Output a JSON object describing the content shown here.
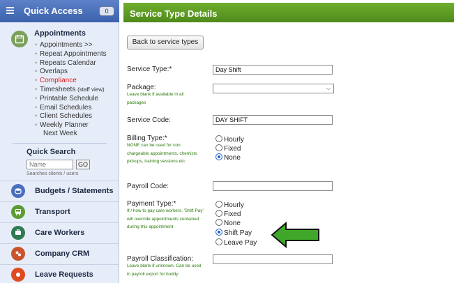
{
  "sidebar": {
    "title": "Quick Access",
    "count": "0",
    "appointments": {
      "title": "Appointments",
      "icon": "calendar-icon",
      "items": [
        {
          "label": "Appointments >>"
        },
        {
          "label": "Repeat Appointments"
        },
        {
          "label": "Repeats Calendar"
        },
        {
          "label": "Overlaps"
        },
        {
          "label": "Compliance",
          "color": "#e01b1b"
        },
        {
          "label": "Timesheets",
          "suffix": "(staff view)"
        },
        {
          "label": "Printable Schedule"
        },
        {
          "label": "Email Schedules"
        },
        {
          "label": "Client Schedules"
        },
        {
          "label": "Weekly Planner"
        },
        {
          "label": "Next Week"
        }
      ]
    },
    "quick_search": {
      "title": "Quick Search",
      "placeholder": "Name",
      "go_label": "GO",
      "hint": "Searches clients / users"
    },
    "modules": [
      {
        "label": "Budgets / Statements",
        "icon": "coins-icon",
        "color": "#4a6fc0"
      },
      {
        "label": "Transport",
        "icon": "bus-icon",
        "color": "#5d9b34"
      },
      {
        "label": "Care Workers",
        "icon": "workers-icon",
        "color": "#2f7a53"
      },
      {
        "label": "Company CRM",
        "icon": "crm-icon",
        "color": "#c9532b"
      },
      {
        "label": "Leave Requests",
        "icon": "leave-icon",
        "color": "#e04a1f"
      }
    ]
  },
  "main": {
    "title": "Service Type Details",
    "back_label": "Back to service types",
    "fields": {
      "service_type": {
        "label": "Service Type:*",
        "value": "Day Shift"
      },
      "package": {
        "label": "Package:",
        "help": "Leave blank if available in all packages"
      },
      "service_code": {
        "label": "Service Code:",
        "value": "DAY SHIFT"
      },
      "billing_type": {
        "label": "Billing Type:*",
        "help": "NONE can be used for non chargeable appointments, chemists pickups, training sessions etc.",
        "options": [
          "Hourly",
          "Fixed",
          "None"
        ],
        "selected": "None"
      },
      "payroll_code": {
        "label": "Payroll Code:",
        "value": ""
      },
      "payment_type": {
        "label": "Payment Type:*",
        "help": "If / how to pay care workers. 'Shift Pay' will override appointments contained during this appointment",
        "options": [
          "Hourly",
          "Fixed",
          "None",
          "Shift Pay",
          "Leave Pay"
        ],
        "selected": "Shift Pay"
      },
      "payroll_classification": {
        "label": "Payroll Classification:",
        "help": "Leave blank if unknown. Can be used in payroll export for buddy"
      }
    }
  },
  "colors": {
    "sidebar_header": "#3b62ad",
    "main_header": "#5a9a22",
    "help_text": "#2b7a0b",
    "arrow": "#3fa82a",
    "radio_selected": "#1f5fc7"
  }
}
